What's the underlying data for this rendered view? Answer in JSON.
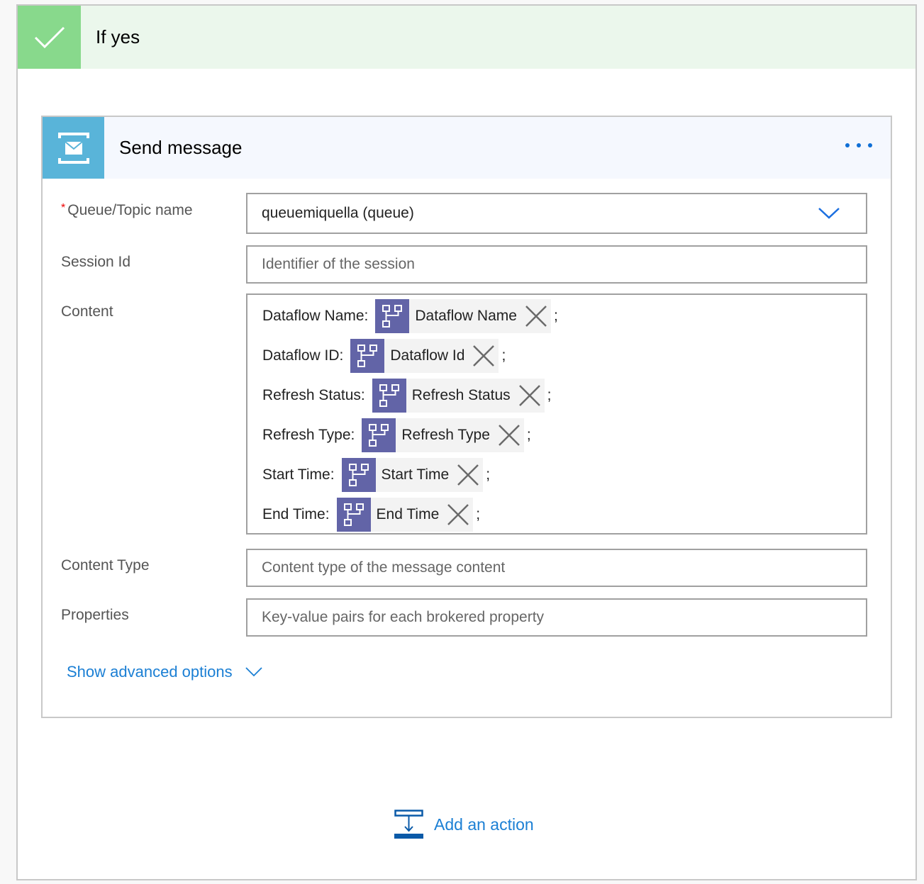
{
  "branch": {
    "title": "If yes",
    "icon": "checkmark-icon",
    "colors": {
      "icon_bg": "#88d98c",
      "header_bg": "#ebf7ec"
    }
  },
  "action_card": {
    "title": "Send message",
    "icon": "service-bus-envelope-icon",
    "more_icon": "ellipsis-icon",
    "colors": {
      "icon_bg": "#59b4d9",
      "header_bg": "#f5f8fe",
      "accent": "#0f6fd6"
    },
    "fields": {
      "queue": {
        "label": "Queue/Topic name",
        "required_marker": "*",
        "value": "queuemiquella (queue)"
      },
      "session_id": {
        "label": "Session Id",
        "placeholder": "Identifier of the session"
      },
      "content": {
        "label": "Content",
        "lines": [
          {
            "label": "Dataflow Name:",
            "token": "Dataflow Name",
            "suffix": ";"
          },
          {
            "label": "Dataflow ID:",
            "token": "Dataflow Id",
            "suffix": ";"
          },
          {
            "label": "Refresh Status:",
            "token": "Refresh Status",
            "suffix": ";"
          },
          {
            "label": "Refresh Type:",
            "token": "Refresh Type",
            "suffix": ";"
          },
          {
            "label": "Start Time:",
            "token": "Start Time",
            "suffix": ";"
          },
          {
            "label": "End Time:",
            "token": "End Time",
            "suffix": ";"
          }
        ],
        "token_icon": "dataflow-tree-icon",
        "token_color": "#6264a7"
      },
      "content_type": {
        "label": "Content Type",
        "placeholder": "Content type of the message content"
      },
      "properties": {
        "label": "Properties",
        "placeholder": "Key-value pairs for each brokered property"
      }
    },
    "advanced_link": "Show advanced options"
  },
  "add_action": {
    "label": "Add an action",
    "icon": "add-action-icon",
    "color": "#1b7fd4"
  }
}
